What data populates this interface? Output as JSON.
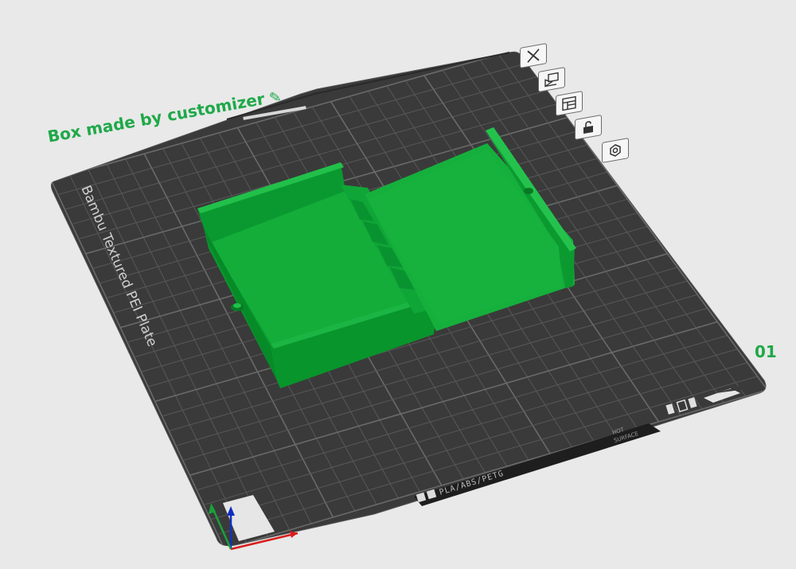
{
  "plate": {
    "name": "Box made by customizer",
    "index": "01",
    "surface_label": "Bambu Textured PEI Plate",
    "material_label": "PLA/ABS/PETG",
    "hot_surface_label_line1": "HOT",
    "hot_surface_label_line2": "SURFACE"
  },
  "toolbar": {
    "buttons": [
      {
        "name": "close-plate-button",
        "icon": "close-icon"
      },
      {
        "name": "arrange-button",
        "icon": "arrange-icon"
      },
      {
        "name": "orient-button",
        "icon": "layout-icon"
      },
      {
        "name": "lock-plate-button",
        "icon": "lock-icon"
      },
      {
        "name": "plate-settings-button",
        "icon": "gear-icon"
      }
    ]
  },
  "colors": {
    "background": "#e8e9e8",
    "plate": "#3a3a3a",
    "grid": "#5c5c5c",
    "model": "#0ea335",
    "accent": "#1fa84a"
  }
}
